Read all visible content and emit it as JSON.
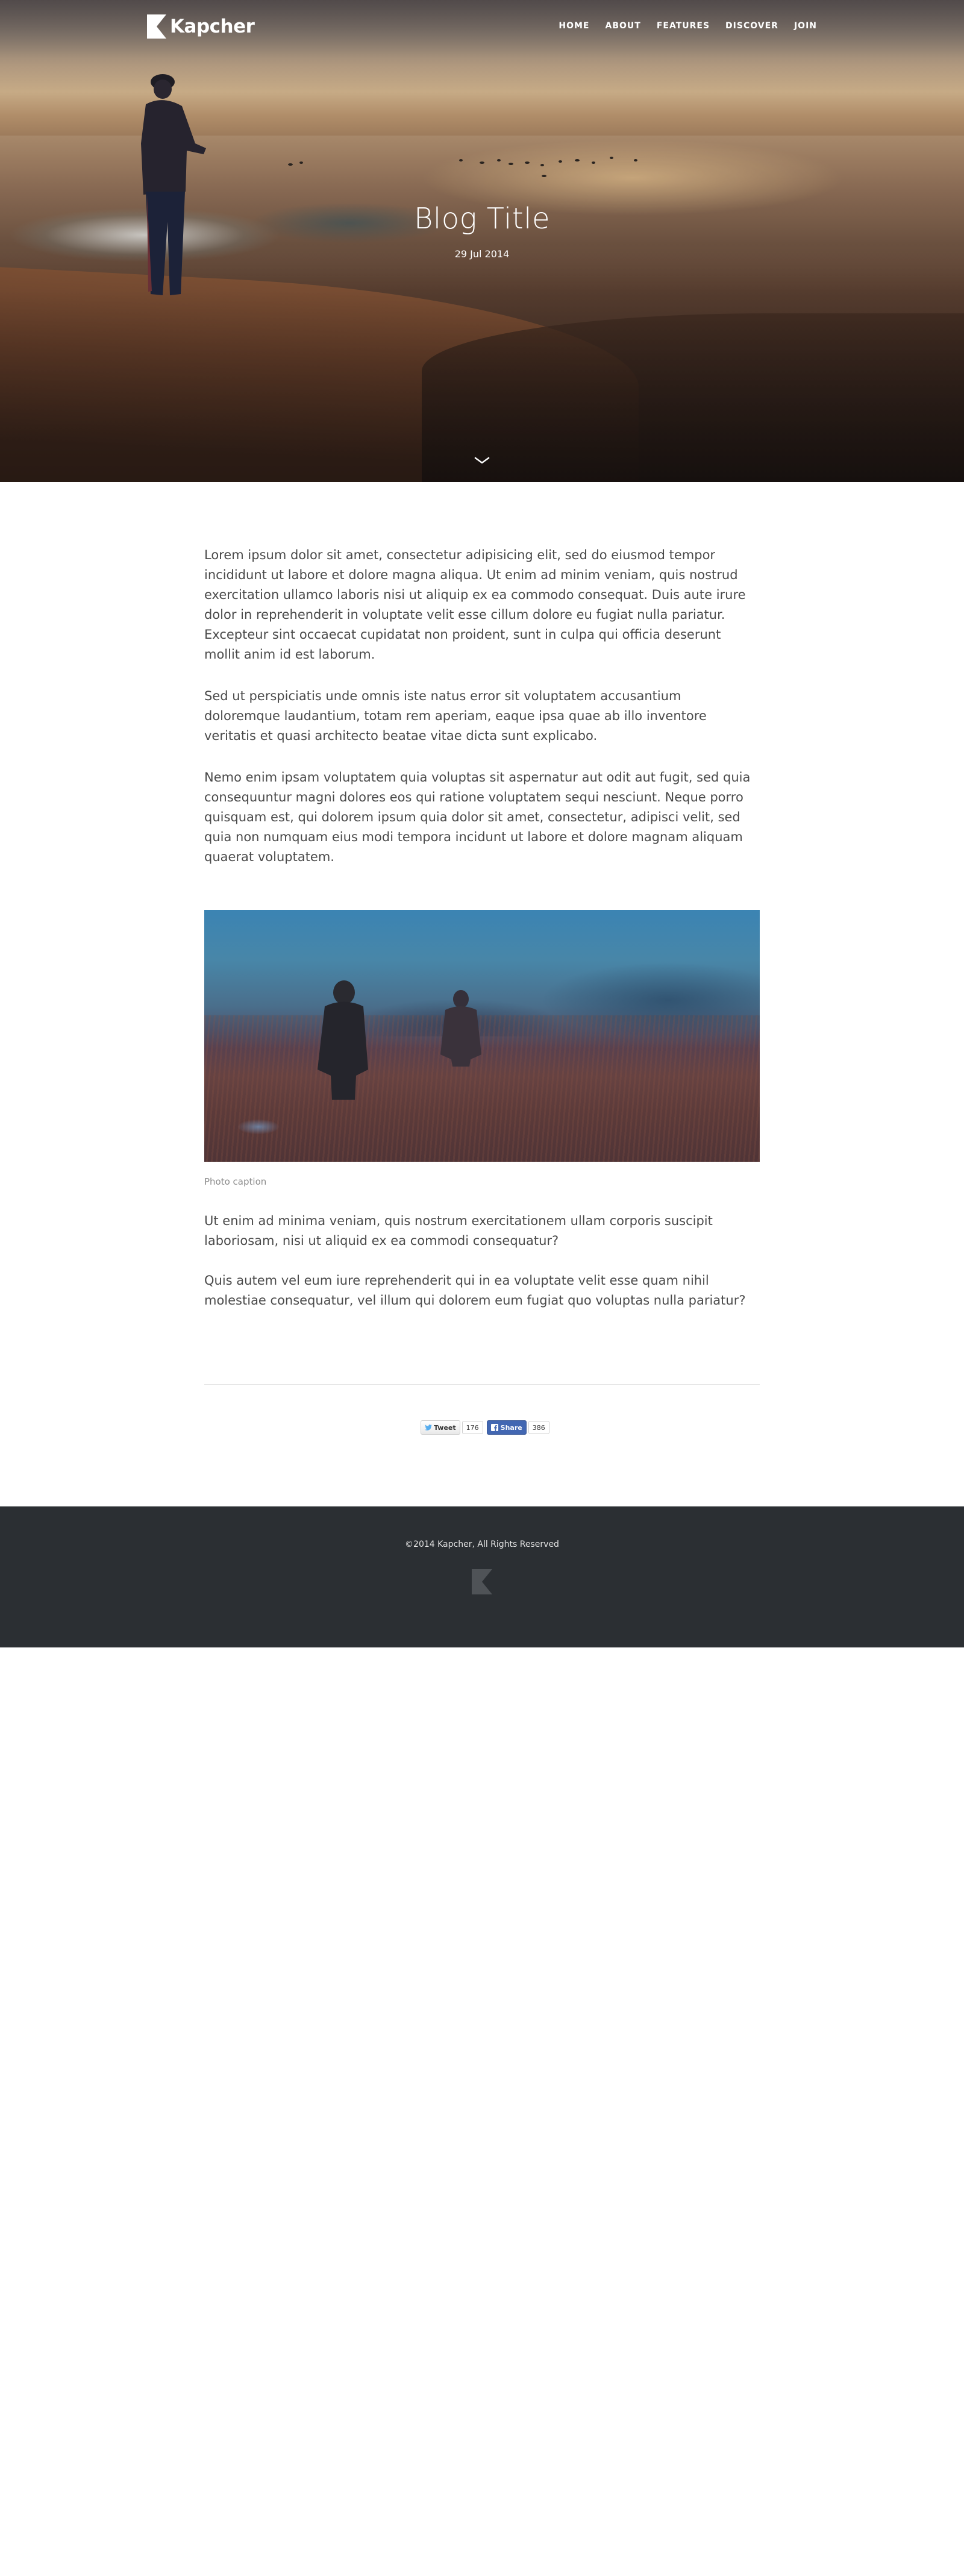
{
  "header": {
    "brand": "Kapcher",
    "nav": [
      {
        "label": "HOME"
      },
      {
        "label": "ABOUT"
      },
      {
        "label": "FEATURES"
      },
      {
        "label": "DISCOVER"
      },
      {
        "label": "JOIN"
      }
    ]
  },
  "hero": {
    "title": "Blog Title",
    "date": "29 Jul 2014",
    "scroll_icon": "chevron-down-icon"
  },
  "article": {
    "paragraphs": [
      "Lorem ipsum dolor sit amet, consectetur adipisicing elit, sed do eiusmod tempor incididunt ut labore et dolore magna aliqua. Ut enim ad minim veniam, quis nostrud exercitation ullamco laboris nisi ut aliquip ex ea commodo consequat. Duis aute irure dolor in reprehenderit in voluptate velit esse cillum dolore eu fugiat nulla pariatur. Excepteur sint occaecat cupidatat non proident, sunt in culpa qui officia deserunt mollit anim id est laborum.",
      "Sed ut perspiciatis unde omnis iste natus error sit voluptatem accusantium doloremque laudantium, totam rem aperiam, eaque ipsa quae ab illo inventore veritatis et quasi architecto beatae vitae dicta sunt explicabo.",
      "Nemo enim ipsam voluptatem quia voluptas sit aspernatur aut odit aut fugit, sed quia consequuntur magni dolores eos qui ratione voluptatem sequi nesciunt. Neque porro quisquam est, qui dolorem ipsum quia dolor sit amet, consectetur, adipisci velit, sed quia non numquam eius modi tempora incidunt ut labore et dolore magnam aliquam quaerat voluptatem."
    ],
    "photo_caption": "Photo caption",
    "paragraphs_after": [
      "Ut enim ad minima veniam, quis nostrum exercitationem ullam corporis suscipit laboriosam, nisi ut aliquid ex ea commodi consequatur?",
      "Quis autem vel eum iure reprehenderit qui in ea voluptate velit esse quam nihil molestiae consequatur, vel illum qui dolorem eum fugiat quo voluptas nulla pariatur?"
    ]
  },
  "share": {
    "tweet_label": "Tweet",
    "tweet_count": "176",
    "share_label": "Share",
    "share_count": "386",
    "twitter_icon": "twitter-bird-icon",
    "facebook_icon": "facebook-icon"
  },
  "footer": {
    "copyright": "©2014 Kapcher, All Rights Reserved"
  },
  "colors": {
    "footer_bg": "#2b2f33",
    "body_text": "#4a4a4a",
    "caption_text": "#8a8a8a",
    "facebook_blue": "#4267b2"
  }
}
